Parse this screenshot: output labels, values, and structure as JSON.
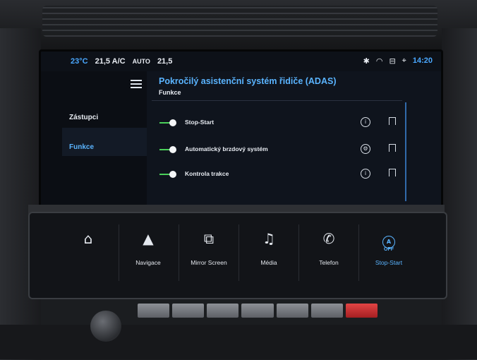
{
  "status": {
    "temp_exterior": "23°C",
    "temp_left": "21,5 A/C",
    "auto": "AUTO",
    "temp_right": "21,5",
    "time": "14:20"
  },
  "sidebar": {
    "items": [
      {
        "label": "Zástupci"
      },
      {
        "label": "Funkce"
      }
    ]
  },
  "panel": {
    "title": "Pokročilý asistenční systém řidiče (ADAS)",
    "subtitle": "Funkce"
  },
  "rows": [
    {
      "label": "Stop-Start"
    },
    {
      "label": "Automatický brzdový systém"
    },
    {
      "label": "Kontrola trakce"
    }
  ],
  "touchbar": {
    "items": [
      {
        "label": ""
      },
      {
        "label": "Navigace"
      },
      {
        "label": "Mirror Screen"
      },
      {
        "label": "Média"
      },
      {
        "label": "Telefon"
      },
      {
        "label": "Stop-Start",
        "badge": "OFF"
      }
    ]
  },
  "colors": {
    "accent": "#5ab4ff",
    "toggle_on": "#4ad05a"
  }
}
